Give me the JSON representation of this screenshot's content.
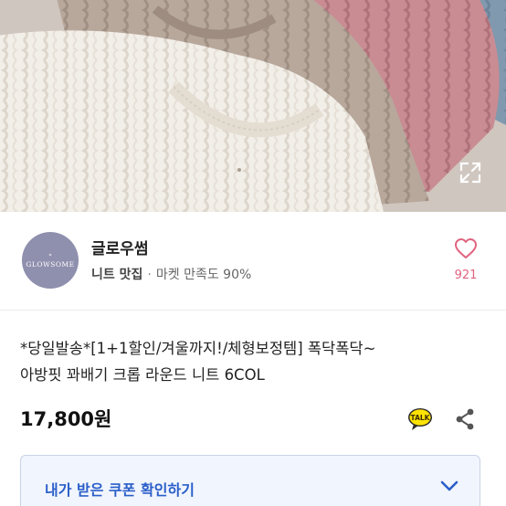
{
  "hero": {
    "image_alt": "",
    "expand_icon": "expand-icon",
    "sweater_colors": [
      "#f3efe9",
      "#b9a99d",
      "#c98c93",
      "#7f96ad"
    ]
  },
  "store": {
    "logo_text": "GLOWSOME",
    "logo_mark": "*",
    "name": "글로우썸",
    "category": "니트 맛집",
    "separator": "·",
    "satisfaction": "마켓 만족도 90%",
    "like_icon": "heart-icon",
    "like_count": "921"
  },
  "product": {
    "title_line1": "*당일발송*[1+1할인/겨울까지!/체형보정템] 폭닥폭닥~",
    "title_line2": "아방핏 꽈배기 크롭 라운드 니트 6COL",
    "price": "17,800원",
    "talk_icon": "kakao-talk-icon",
    "talk_label": "TALK",
    "share_icon": "share-icon"
  },
  "coupon": {
    "label": "내가 받은 쿠폰 확인하기",
    "chevron_icon": "chevron-down-icon"
  },
  "colors": {
    "accent_blue": "#2a5fc9",
    "like_pink": "#e0637f",
    "kakao_yellow": "#ffe300",
    "coupon_bg": "#f1f5fd"
  }
}
